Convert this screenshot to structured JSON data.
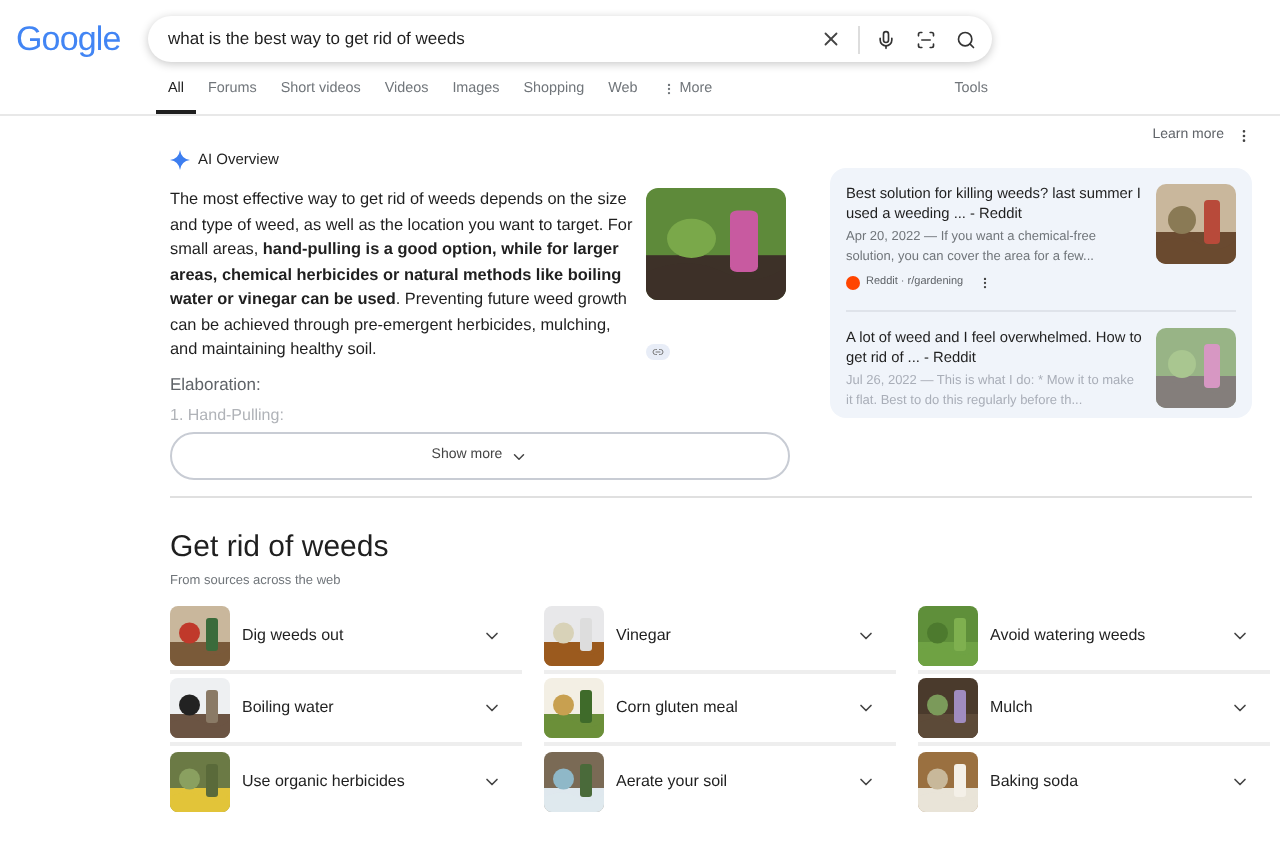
{
  "logo": "Google",
  "search": {
    "value": "what is the best way to get rid of weeds"
  },
  "tabs": [
    {
      "label": "All",
      "selected": true
    },
    {
      "label": "Forums",
      "selected": false
    },
    {
      "label": "Short videos",
      "selected": false
    },
    {
      "label": "Videos",
      "selected": false
    },
    {
      "label": "Images",
      "selected": false
    },
    {
      "label": "Shopping",
      "selected": false
    },
    {
      "label": "Web",
      "selected": false
    },
    {
      "label": "More",
      "selected": false
    }
  ],
  "tools": "Tools",
  "ai_overview": {
    "title": "AI Overview",
    "learn_more": "Learn more",
    "paragraph": "The most effective way to get rid of weeds depends on the size and type of weed, as well as the location you want to target. For small areas, **hand-pulling is a good option, while for larger areas, chemical herbicides or natural methods like boiling water or vinegar can be used**. Preventing future weed growth can be achieved through pre-emergent herbicides, mulching, and maintaining healthy soil.",
    "elaboration": "Elaboration:",
    "faded_item": "1. Hand-Pulling:",
    "show_more": "Show more",
    "sources": [
      {
        "title": "Best solution for killing weeds? last summer I used a weeding ... - Reddit",
        "snippet": "Apr 20, 2022 — If you want a chemical-free solution, you can cover the area for a few...",
        "site": "Reddit · r/gardening",
        "faded": false
      },
      {
        "title": "A lot of weed and I feel overwhelmed. How to get rid of ... - Reddit",
        "snippet": "Jul 26, 2022 — This is what I do: * Mow it to make it flat. Best to do this regularly before th...",
        "faded": true
      }
    ]
  },
  "section": {
    "title": "Get rid of weeds",
    "subtitle": "From sources across the web",
    "items": [
      {
        "label": "Dig weeds out"
      },
      {
        "label": "Vinegar"
      },
      {
        "label": "Avoid watering weeds"
      },
      {
        "label": "Boiling water"
      },
      {
        "label": "Corn gluten meal"
      },
      {
        "label": "Mulch"
      },
      {
        "label": "Use organic herbicides"
      },
      {
        "label": "Aerate your soil"
      },
      {
        "label": "Baking soda"
      }
    ]
  }
}
